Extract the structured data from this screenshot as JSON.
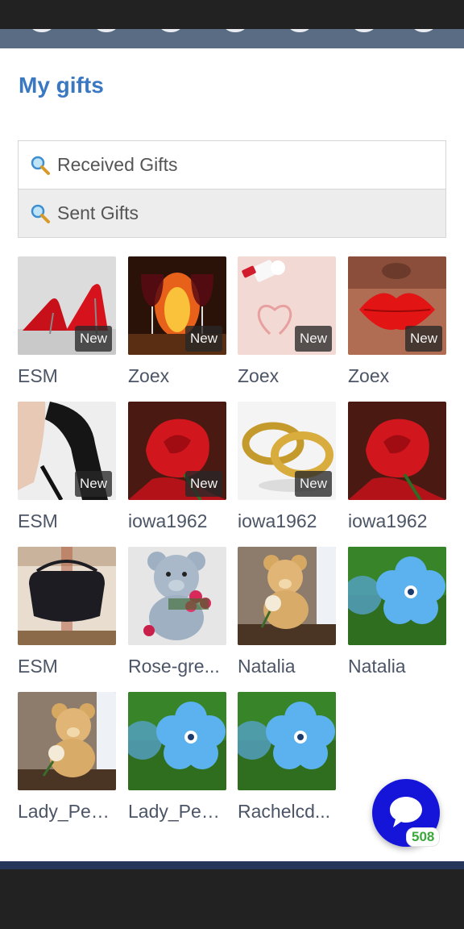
{
  "page": {
    "title": "My gifts"
  },
  "filters": [
    {
      "label": "Received Gifts",
      "icon": "search-icon"
    },
    {
      "label": "Sent Gifts",
      "icon": "search-icon"
    }
  ],
  "gifts": [
    {
      "name": "ESM",
      "badge": "New",
      "image": "red-high-heels"
    },
    {
      "name": "Zoex",
      "badge": "New",
      "image": "wine-glasses-fireplace"
    },
    {
      "name": "Zoex",
      "badge": "New",
      "image": "lipstick-heart"
    },
    {
      "name": "Zoex",
      "badge": "New",
      "image": "red-lips"
    },
    {
      "name": "ESM",
      "badge": "New",
      "image": "black-stiletto"
    },
    {
      "name": "iowa1962",
      "badge": "New",
      "image": "red-rose"
    },
    {
      "name": "iowa1962",
      "badge": "New",
      "image": "gold-rings"
    },
    {
      "name": "iowa1962",
      "badge": "",
      "image": "red-rose"
    },
    {
      "name": "ESM",
      "badge": "",
      "image": "black-handbag"
    },
    {
      "name": "Rose-gre...",
      "badge": "",
      "image": "teddy-bear-roses"
    },
    {
      "name": "Natalia",
      "badge": "",
      "image": "teddy-bear-rose"
    },
    {
      "name": "Natalia",
      "badge": "",
      "image": "blue-flower"
    },
    {
      "name": "Lady_Pen...",
      "badge": "",
      "image": "teddy-bear-rose"
    },
    {
      "name": "Lady_Pen...",
      "badge": "",
      "image": "blue-flower"
    },
    {
      "name": "Rachelcd...",
      "badge": "",
      "image": "blue-flower"
    }
  ],
  "chat": {
    "icon": "chat-bubble-icon",
    "count": "508"
  },
  "colors": {
    "accent": "#3a78c2",
    "chat_button": "#1515d9",
    "count_text": "#3aa83a"
  }
}
